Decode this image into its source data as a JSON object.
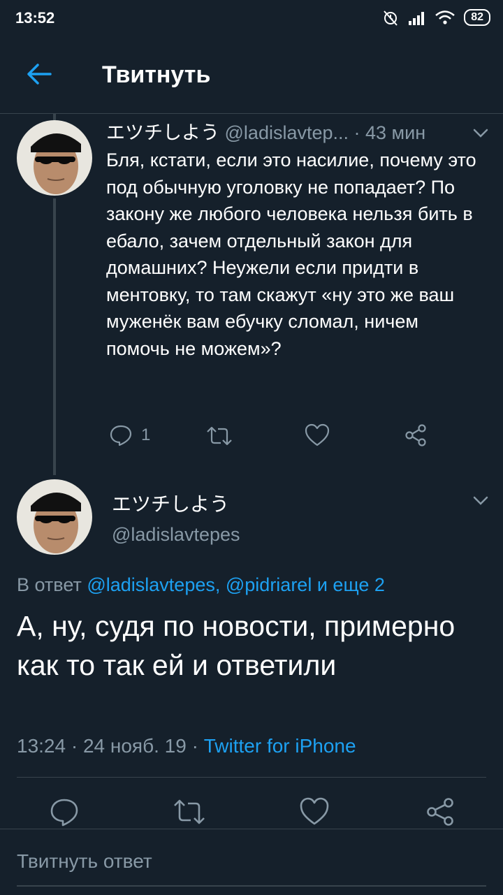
{
  "status_bar": {
    "time": "13:52",
    "battery": "82"
  },
  "header": {
    "title": "Твитнуть"
  },
  "parent_tweet": {
    "name": "エツチしよう",
    "handle": "@ladislavtep...",
    "time": "· 43 мин",
    "text": "Бля, кстати, если это насилие, почему это под обычную уголовку не попадает? По закону же любого человека нельзя бить в ебало, зачем отдельный закон для домашних? Неужели если придти в ментовку, то там скажут «ну это же ваш муженёк вам ебучку сломал, ничем помочь не можем»?",
    "reply_count": "1"
  },
  "main_tweet": {
    "name": "エツチしよう",
    "handle": "@ladislavtepes",
    "reply_prefix": "В ответ",
    "reply_mention_1": "@ladislavtepes,",
    "reply_mention_2": "@pidriarel",
    "reply_more": "и еще 2",
    "text": "А, ну, судя по новости, примерно как то так ей и ответили",
    "timestamp": "13:24 · 24 нояб. 19 ·",
    "source": "Twitter for iPhone"
  },
  "reply_box": {
    "placeholder": "Твитнуть ответ"
  },
  "colors": {
    "background": "#15202b",
    "accent": "#1da1f2",
    "muted": "#8899a6",
    "border": "#38444d"
  }
}
